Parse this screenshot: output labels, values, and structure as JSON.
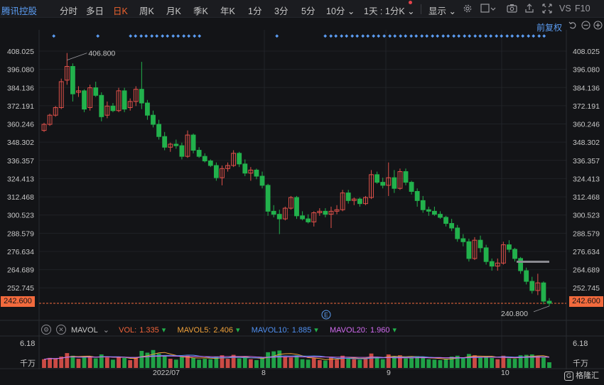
{
  "toolbar": {
    "stock_name": "腾讯控股",
    "periods": [
      "分时",
      "多日",
      "日K",
      "周K",
      "月K",
      "季K",
      "年K",
      "1分",
      "3分",
      "5分",
      "10分 ⌄",
      "1天 : 1分K ⌄"
    ],
    "active_period": "日K",
    "display_label": "显示 ⌄",
    "icons": [
      "gear-icon",
      "checkbox-icon",
      "camera-icon",
      "share-icon",
      "expand-icon"
    ],
    "vs_label": "VS",
    "f10_label": "F10"
  },
  "subheader": {
    "adjust_label": "前复权",
    "icons": [
      "undo-icon",
      "minus-circle-icon",
      "plus-circle-icon"
    ]
  },
  "price_axis": {
    "labels": [
      "408.025",
      "396.080",
      "384.136",
      "372.191",
      "360.246",
      "348.302",
      "336.357",
      "324.413",
      "312.468",
      "300.523",
      "288.579",
      "276.634",
      "264.689",
      "252.745"
    ],
    "current_price_tag": "242.600",
    "high_annotation": "406.800",
    "low_annotation": "240.800",
    "event_marker": "E"
  },
  "volume": {
    "indicator": "MAVOL",
    "vol": {
      "label": "VOL:",
      "value": "1.335",
      "color": "#f0633a"
    },
    "mavol5": {
      "label": "MAVOL5:",
      "value": "2.406",
      "color": "#f0a13a"
    },
    "mavol10": {
      "label": "MAVOL10:",
      "value": "1.885",
      "color": "#4f8ff0"
    },
    "mavol20": {
      "label": "MAVOL20:",
      "value": "1.960",
      "color": "#d16bf0"
    },
    "axis_top": "6.18",
    "unit": "千万"
  },
  "x_axis": {
    "labels": [
      "2022/07",
      "8",
      "9",
      "10"
    ]
  },
  "brand": "格隆汇",
  "colors": {
    "up": "#e0514a",
    "down": "#22b14c",
    "accent": "#f0632e",
    "link": "#5b9cf2"
  },
  "chart_data": {
    "type": "candlestick",
    "price_axis_range": [
      240.8,
      408.025
    ],
    "note_dates": "daily bars, 2022-06 through 2022-10",
    "ohlc": [
      [
        356,
        361,
        355,
        360
      ],
      [
        360,
        367,
        359,
        366
      ],
      [
        366,
        372,
        365,
        371
      ],
      [
        371,
        390,
        370,
        388
      ],
      [
        389,
        406.8,
        386,
        398
      ],
      [
        398,
        400,
        375,
        380
      ],
      [
        381,
        385,
        378,
        382
      ],
      [
        382,
        383,
        368,
        370
      ],
      [
        371,
        386,
        369,
        384
      ],
      [
        384,
        388,
        378,
        379
      ],
      [
        379,
        381,
        362,
        365
      ],
      [
        366,
        375,
        364,
        372
      ],
      [
        372,
        374,
        368,
        369
      ],
      [
        369,
        384,
        368,
        382
      ],
      [
        382,
        384,
        368,
        370
      ],
      [
        371,
        377,
        369,
        375
      ],
      [
        375,
        385,
        372,
        383
      ],
      [
        383,
        401,
        370,
        374
      ],
      [
        374,
        376,
        363,
        366
      ],
      [
        366,
        369,
        358,
        360
      ],
      [
        360,
        363,
        350,
        352
      ],
      [
        352,
        355,
        343,
        345
      ],
      [
        345,
        348,
        342,
        347
      ],
      [
        347,
        350,
        344,
        346
      ],
      [
        346,
        348,
        337,
        339
      ],
      [
        339,
        356,
        338,
        353
      ],
      [
        353,
        354,
        341,
        343
      ],
      [
        343,
        345,
        338,
        339
      ],
      [
        339,
        341,
        335,
        336
      ],
      [
        336,
        337,
        332,
        333
      ],
      [
        333,
        335,
        323,
        325
      ],
      [
        325,
        333,
        320,
        331
      ],
      [
        331,
        335,
        329,
        333
      ],
      [
        333,
        343,
        332,
        341
      ],
      [
        341,
        342,
        332,
        334
      ],
      [
        334,
        337,
        326,
        328
      ],
      [
        328,
        332,
        323,
        330
      ],
      [
        330,
        331,
        324,
        326
      ],
      [
        326,
        329,
        318,
        320
      ],
      [
        320,
        321,
        300,
        303
      ],
      [
        303,
        307,
        299,
        301
      ],
      [
        301,
        304,
        288,
        298
      ],
      [
        298,
        306,
        297,
        305
      ],
      [
        305,
        313,
        304,
        312
      ],
      [
        312,
        313,
        298,
        300
      ],
      [
        300,
        303,
        297,
        298
      ],
      [
        298,
        301,
        295,
        296
      ],
      [
        296,
        303,
        293,
        302
      ],
      [
        302,
        305,
        300,
        303
      ],
      [
        303,
        305,
        299,
        301
      ],
      [
        301,
        306,
        292,
        303
      ],
      [
        303,
        307,
        301,
        304
      ],
      [
        304,
        317,
        303,
        315
      ],
      [
        315,
        317,
        308,
        310
      ],
      [
        310,
        312,
        307,
        311
      ],
      [
        311,
        312,
        306,
        308
      ],
      [
        308,
        313,
        307,
        312
      ],
      [
        312,
        330,
        311,
        327
      ],
      [
        327,
        329,
        321,
        322
      ],
      [
        322,
        325,
        318,
        320
      ],
      [
        320,
        335,
        313,
        325
      ],
      [
        325,
        330,
        315,
        318
      ],
      [
        318,
        331,
        317,
        329
      ],
      [
        329,
        331,
        320,
        322
      ],
      [
        322,
        323,
        314,
        316
      ],
      [
        316,
        318,
        306,
        310
      ],
      [
        310,
        313,
        302,
        304
      ],
      [
        304,
        306,
        300,
        303
      ],
      [
        303,
        306,
        300,
        301
      ],
      [
        301,
        303,
        298,
        299
      ],
      [
        299,
        300,
        293,
        295
      ],
      [
        295,
        298,
        290,
        292
      ],
      [
        292,
        294,
        283,
        285
      ],
      [
        285,
        288,
        280,
        283
      ],
      [
        283,
        285,
        270,
        272
      ],
      [
        272,
        286,
        271,
        284
      ],
      [
        284,
        287,
        276,
        279
      ],
      [
        279,
        281,
        268,
        270
      ],
      [
        270,
        272,
        264,
        267
      ],
      [
        267,
        272,
        264,
        269
      ],
      [
        269,
        283,
        268,
        281
      ],
      [
        281,
        284,
        276,
        278
      ],
      [
        278,
        279,
        270,
        272
      ],
      [
        272,
        273,
        262,
        264
      ],
      [
        264,
        266,
        255,
        257
      ],
      [
        257,
        260,
        249,
        251
      ],
      [
        251,
        262,
        248,
        256
      ],
      [
        256,
        257,
        242,
        244
      ],
      [
        244,
        246,
        240.8,
        242.6
      ]
    ],
    "volume": [
      2.0,
      2.3,
      2.1,
      2.6,
      3.4,
      2.8,
      2.1,
      2.5,
      2.7,
      2.2,
      3.1,
      2.4,
      1.9,
      2.6,
      2.3,
      1.8,
      2.4,
      3.9,
      3.5,
      4.1,
      3.3,
      2.9,
      2.1,
      1.9,
      2.5,
      2.8,
      2.3,
      1.9,
      2.1,
      2.0,
      2.6,
      2.9,
      2.1,
      3.0,
      2.2,
      2.4,
      2.0,
      1.8,
      2.3,
      3.6,
      3.8,
      4.0,
      2.6,
      2.4,
      2.9,
      2.0,
      1.9,
      2.2,
      1.8,
      1.7,
      2.5,
      1.9,
      2.8,
      2.3,
      2.0,
      1.9,
      2.1,
      3.3,
      2.4,
      2.0,
      3.1,
      2.6,
      2.9,
      2.2,
      2.4,
      2.7,
      2.3,
      2.0,
      1.9,
      1.8,
      2.1,
      2.6,
      2.8,
      2.2,
      3.2,
      2.9,
      2.4,
      2.6,
      2.3,
      2.0,
      2.8,
      2.2,
      2.1,
      2.9,
      3.0,
      3.1,
      2.7,
      2.4,
      1.3
    ],
    "volume_axis_max": 6.18,
    "volume_unit": "千万"
  }
}
